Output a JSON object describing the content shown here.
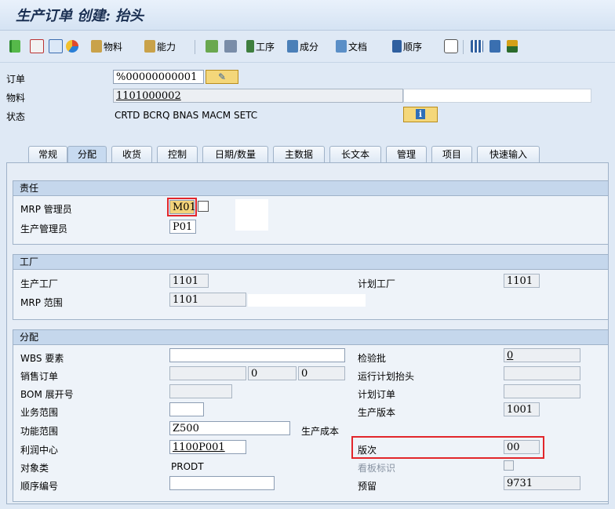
{
  "window": {
    "title": "生产订单 创建: 抬头"
  },
  "toolbar": {
    "material_label": "物料",
    "capacity_label": "能力",
    "operation_label": "工序",
    "component_label": "成分",
    "document_label": "文档",
    "sequence_label": "顺序"
  },
  "header": {
    "order_label": "订单",
    "order_value": "%00000000001",
    "material_label": "物料",
    "material_value": "1101000002",
    "status_label": "状态",
    "status_value": "CRTD BCRQ BNAS MACM SETC"
  },
  "tabs": [
    "常规",
    "分配",
    "收货",
    "控制",
    "日期/数量",
    "主数据",
    "长文本",
    "管理",
    "项目",
    "快速输入"
  ],
  "active_tab": "分配",
  "responsibility": {
    "title": "责任",
    "mrp_controller_label": "MRP 管理员",
    "mrp_controller_value": "M01",
    "prod_supervisor_label": "生产管理员",
    "prod_supervisor_value": "P01"
  },
  "plant": {
    "title": "工厂",
    "prod_plant_label": "生产工厂",
    "prod_plant_value": "1101",
    "planning_plant_label": "计划工厂",
    "planning_plant_value": "1101",
    "mrp_area_label": "MRP 范围",
    "mrp_area_value": "1101"
  },
  "assignment": {
    "title": "分配",
    "wbs_label": "WBS 要素",
    "wbs_value": "",
    "inspection_lot_label": "检验批",
    "inspection_lot_value": "0",
    "sales_order_label": "销售订单",
    "sales_order_value": "",
    "sales_order_item": "0",
    "sales_order_sched": "0",
    "run_schedule_label": "运行计划抬头",
    "run_schedule_value": "",
    "bom_explosion_label": "BOM 展开号",
    "bom_explosion_value": "",
    "planned_order_label": "计划订单",
    "planned_order_value": "",
    "business_area_label": "业务范围",
    "business_area_value": "",
    "production_version_label": "生产版本",
    "production_version_value": "1001",
    "functional_area_label": "功能范围",
    "functional_area_value": "Z500",
    "production_cost_label": "生产成本",
    "profit_center_label": "利润中心",
    "profit_center_value": "1100P001",
    "version_label": "版次",
    "version_value": "00",
    "object_class_label": "对象类",
    "object_class_value": "PRODT",
    "kanban_label": "看板标识",
    "sequence_no_label": "顺序编号",
    "sequence_no_value": "",
    "reservation_label": "预留",
    "reservation_value": "9731"
  },
  "colors": {
    "highlight": "#e2262b",
    "accent": "#1a2f52"
  }
}
